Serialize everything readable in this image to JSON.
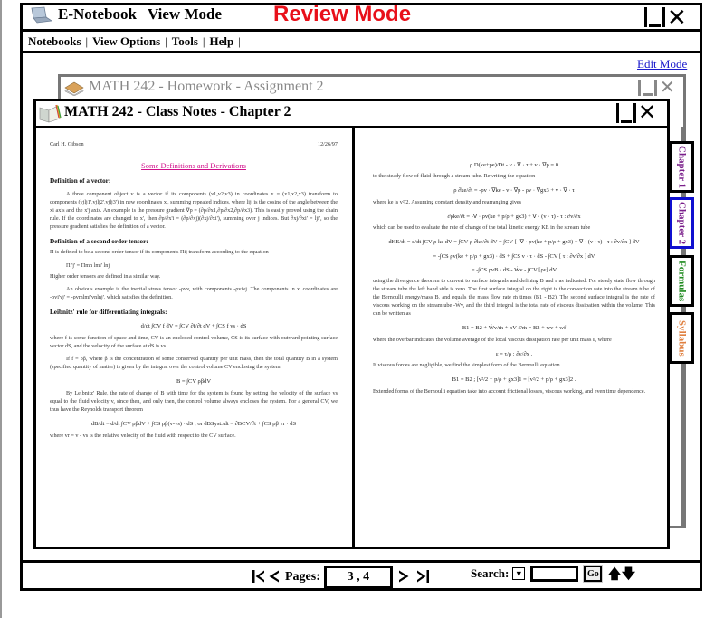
{
  "app": {
    "title": "E-Notebook",
    "mode_label": "View Mode",
    "review_banner": "Review Mode",
    "icon": "laptop-icon"
  },
  "menu": {
    "items": [
      "Notebooks",
      "View Options",
      "Tools",
      "Help"
    ],
    "separator": "|"
  },
  "edit_mode_link": "Edit Mode",
  "homework_window": {
    "title": "MATH 242 - Homework - Assignment 2",
    "icon": "books-icon"
  },
  "notes_window": {
    "title": "MATH 242 - Class Notes - Chapter 2",
    "icon": "open-notebook-icon"
  },
  "window_controls": {
    "minimize": "minimize-icon",
    "close": "close-icon"
  },
  "tabs": [
    {
      "label": "Chapter 1",
      "color": "#7a1f8a",
      "active": false
    },
    {
      "label": "Chapter 2",
      "color": "#7a1f8a",
      "active": true,
      "border_color": "#1010d0"
    },
    {
      "label": "Formulas",
      "color": "#1f8a1f",
      "active": false
    },
    {
      "label": "Syllabus",
      "color": "#e08040",
      "active": false
    }
  ],
  "left_page": {
    "author": "Carl H. Gibson",
    "date": "12/26/97",
    "title": "Some Definitions and Derivations",
    "blocks": [
      {
        "type": "heading",
        "text": "Definition of a vector:"
      },
      {
        "type": "indent",
        "text": "A three component object v is a vector if its components (v1,v2,v3) in coordinates x = (x1,x2,x3) transform to components (vjlj1',vjlj2',vjlj3') in new coordinates x', summing repeated indices, where lij' is the cosine of the angle between the xi axis and the x'j axis. An example is the pressure gradient ∇p = (∂p/∂x1,∂p/∂x2,∂p/∂x3). This is easily proved using the chain rule. If the coordinates are changed to x', then ∂p/∂x'i = (∂p/∂xj)(∂xj/∂xi'), summing over j indices. But ∂xj/∂xi' = lji', so the pressure gradient satisfies the definition of a vector."
      },
      {
        "type": "heading",
        "text": "Definition of a second order tensor:"
      },
      {
        "type": "plain",
        "text": "Π is defined to be a second order tensor if its components Πij transform according to the equation"
      },
      {
        "type": "plain-indent",
        "text": "Πi'j' = Πmn lmi' lnj'"
      },
      {
        "type": "plain",
        "text": "Higher order tensors are defined in a similar way."
      },
      {
        "type": "indent",
        "text": "An obvious example is the inertial stress tensor -ρvv, with components -ρvivj. The components in x' coordinates are -ρvi'vj' = -ρvmlmi'vnlnj', which satisfies the definition."
      },
      {
        "type": "heading",
        "text": "Leibnitz' rule for differentiating integrals:"
      },
      {
        "type": "equation",
        "text": "d/dt ∫CV f dV = ∫CV ∂f/∂t dV + ∫CS f vs · dS"
      },
      {
        "type": "just",
        "text": "where f is some function of space and time, CV is an enclosed control volume, CS is its surface with outward pointing surface vector dS, and the velocity of the surface at dS is vs."
      },
      {
        "type": "indent",
        "text": "If f = ρβ, where β is the concentration of some conserved quantity per unit mass, then the total quantity B in a system (specified quantity of matter) is given by the integral over the control volume CV enclosing the system"
      },
      {
        "type": "equation",
        "text": "B = ∫CV ρβdV"
      },
      {
        "type": "indent",
        "text": "By Leibnitz' Rule, the rate of change of B with time for the system is found by setting the velocity of the surface vs equal to the fluid velocity v, since then, and only then, the control volume always encloses the system. For a general CV, we thus have the Reynolds transport theorem"
      },
      {
        "type": "equation",
        "text": "dB/dt = d/dt ∫CV ρβdV + ∫CS ρβ(v-vs) · dS ; or dBSyst./dt = ∂BCV/∂t + ∫CS ρβ vr · dS"
      },
      {
        "type": "plain",
        "text": "where vr = v - vs is the relative velocity of the fluid with respect to the CV surface."
      }
    ]
  },
  "right_page": {
    "blocks": [
      {
        "type": "equation",
        "text": "ρ D(ke+pe)/Dt - v · ∇ · τ + v · ∇p = 0"
      },
      {
        "type": "plain",
        "text": "to the steady flow of fluid through a stream tube. Rewriting the equation"
      },
      {
        "type": "equation",
        "text": "ρ ∂ke/∂t = -ρv · ∇ke - v · ∇p - ρv · ∇gx3 + v · ∇ · τ"
      },
      {
        "type": "plain",
        "text": "where ke is v²/2. Assuming constant density and rearranging gives"
      },
      {
        "type": "equation",
        "text": "∂ρke/∂t = -∇ · ρv(ke + p/ρ + gx3) + ∇ · (v · τ) - τ : ∂v/∂x"
      },
      {
        "type": "plain",
        "text": "which can be used to evaluate the rate of change of the total kinetic energy KE in the stream tube"
      },
      {
        "type": "equation",
        "text": "dKE/dt = d/dt ∫CV ρ ke dV = ∫CV ρ ∂ke/∂t dV = ∫CV [ -∇ · ρv(ke + p/ρ + gx3) + ∇ · (v · τ) - τ : ∂v/∂x ] dV"
      },
      {
        "type": "equation",
        "text": "= -∫CS ρv(ke + p/ρ + gx3) · dS + ∫CS v · τ · dS - ∫CV [ τ : ∂v/∂x ] dV"
      },
      {
        "type": "equation",
        "text": "= -∫CS ρvB · dS - Ẇv - ∫CV [ρε] dV"
      },
      {
        "type": "just",
        "text": "using the divergence theorem to convert to surface integrals and defining B and ε as indicated. For steady state flow through the stream tube the left hand side is zero. The first surface integral on the right is the convection rate into the stream tube of the Bernoulli energy/mass B, and equals the mass flow rate ṁ times (B1 - B2). The second surface integral is the rate of viscous working on the streamtube -Ẇv, and the third integral is the total rate of viscous dissipation within the volume. This can be written as"
      },
      {
        "type": "equation",
        "text": "B1 = B2 + Ẇv/ṁ + ρV ε̄/ṁ = B2 + wv + wf"
      },
      {
        "type": "just",
        "text": "where the overbar indicates the volume average of the local viscous dissipation rate per unit mass ε, where"
      },
      {
        "type": "equation",
        "text": "ε = τ/ρ : ∂v/∂x ."
      },
      {
        "type": "plain",
        "text": "If viscous forces are negligible, we find the simplest form of the Bernoulli equation"
      },
      {
        "type": "equation",
        "text": "B1 = B2 ; [v²/2 + p/ρ + gx3]1 = [v²/2 + p/ρ + gx3]2 ."
      },
      {
        "type": "just",
        "text": "Extended forms of the Bernoulli equation take into account frictional losses, viscous working, and even time dependence."
      }
    ]
  },
  "footer": {
    "pages_label": "Pages:",
    "pages_value": "3 , 4",
    "first_icon": "first-page-icon",
    "prev_icon": "prev-page-icon",
    "next_icon": "next-page-icon",
    "last_icon": "last-page-icon",
    "search_label": "Search:",
    "search_value": "",
    "go_label": "Go",
    "up_icon": "search-up-icon",
    "down_icon": "search-down-icon"
  }
}
